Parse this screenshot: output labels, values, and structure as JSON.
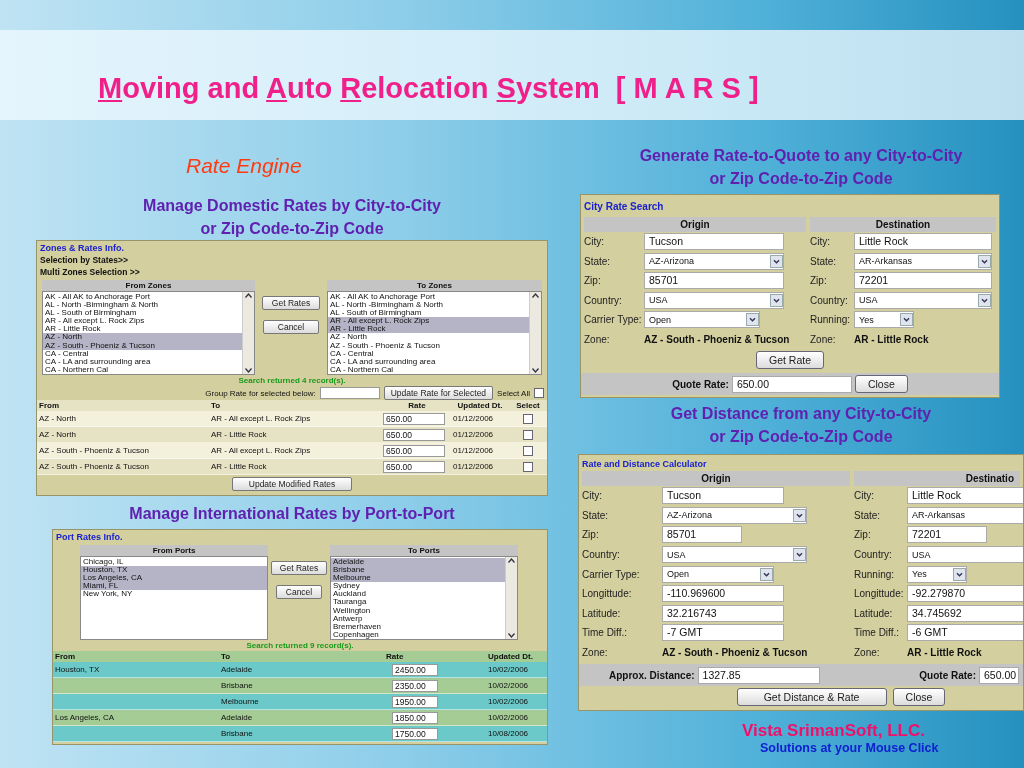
{
  "title": {
    "parts": [
      {
        "text": "M",
        "underlined": true
      },
      {
        "text": "oving and ",
        "underlined": false
      },
      {
        "text": "A",
        "underlined": true
      },
      {
        "text": "uto ",
        "underlined": false
      },
      {
        "text": "R",
        "underlined": true
      },
      {
        "text": "elocation ",
        "underlined": false
      },
      {
        "text": "S",
        "underlined": true
      },
      {
        "text": "ystem  [ M A R S ]",
        "underlined": false
      }
    ]
  },
  "left": {
    "subtitle": "Rate Engine",
    "domestic_heading": [
      "Manage Domestic Rates by City-to-City",
      "or Zip Code-to-Zip Code"
    ],
    "zones_panel": {
      "title": "Zones & Rates Info.",
      "links": [
        "Selection by States>>",
        "Multi Zones Selection >>"
      ],
      "from_list": {
        "header": "From Zones",
        "scrollbar": true,
        "items": [
          {
            "label": "AK - All AK to Anchorage Port",
            "selected": false
          },
          {
            "label": "AL - North -Birmingham & North",
            "selected": false
          },
          {
            "label": "AL - South of Birmingham",
            "selected": false
          },
          {
            "label": "AR - All except L. Rock Zips",
            "selected": false
          },
          {
            "label": "AR - Little Rock",
            "selected": false
          },
          {
            "label": "AZ - North",
            "selected": true
          },
          {
            "label": "AZ - South - Phoeniz & Tucson",
            "selected": true
          },
          {
            "label": "CA - Central",
            "selected": false
          },
          {
            "label": "CA - LA and surrounding area",
            "selected": false
          },
          {
            "label": "CA - Northern Cal",
            "selected": false
          }
        ]
      },
      "buttons": [
        "Get Rates",
        "Cancel"
      ],
      "to_list": {
        "header": "To Zones",
        "scrollbar": true,
        "items": [
          {
            "label": "AK - All AK to Anchorage Port",
            "selected": false
          },
          {
            "label": "AL - North -Birmingham & North",
            "selected": false
          },
          {
            "label": "AL - South of Birmingham",
            "selected": false
          },
          {
            "label": "AR - All except L. Rock Zips",
            "selected": true
          },
          {
            "label": "AR - Little Rock",
            "selected": true
          },
          {
            "label": "AZ - North",
            "selected": false
          },
          {
            "label": "AZ - South - Phoeniz & Tucson",
            "selected": false
          },
          {
            "label": "CA - Central",
            "selected": false
          },
          {
            "label": "CA - LA and surrounding area",
            "selected": false
          },
          {
            "label": "CA - Northern Cal",
            "selected": false
          }
        ]
      },
      "status": "Search returned 4 record(s).",
      "group_rate": {
        "label": "Group Rate for selected below:",
        "button": "Update Rate for Selected",
        "select_all": {
          "label": "Select All",
          "checked": false
        }
      },
      "table": {
        "columns": [
          "From",
          "To",
          "Rate",
          "Updated Dt.",
          "Select"
        ],
        "rows": [
          {
            "from": "AZ - North",
            "to": "AR - All except L. Rock Zips",
            "rate": "650.00",
            "updated": "01/12/2006",
            "checked": false
          },
          {
            "from": "AZ - North",
            "to": "AR - Little Rock",
            "rate": "650.00",
            "updated": "01/12/2006",
            "checked": false
          },
          {
            "from": "AZ - South - Phoeniz & Tucson",
            "to": "AR - All except L. Rock Zips",
            "rate": "650.00",
            "updated": "01/12/2006",
            "checked": false
          },
          {
            "from": "AZ - South - Phoeniz & Tucson",
            "to": "AR - Little Rock",
            "rate": "650.00",
            "updated": "01/12/2006",
            "checked": false
          }
        ]
      },
      "update_button": "Update Modified Rates"
    },
    "international_heading": "Manage International Rates by Port-to-Port",
    "ports_panel": {
      "title": "Port Rates Info.",
      "from_list": {
        "header": "From Ports",
        "scrollbar": false,
        "items": [
          {
            "label": "Chicago, IL",
            "selected": false
          },
          {
            "label": "Houston, TX",
            "selected": true
          },
          {
            "label": "Los Angeles, CA",
            "selected": true
          },
          {
            "label": "Miami, FL",
            "selected": true
          },
          {
            "label": "New York, NY",
            "selected": false
          }
        ]
      },
      "buttons": [
        "Get Rates",
        "Cancel"
      ],
      "to_list": {
        "header": "To Ports",
        "scrollbar": true,
        "items": [
          {
            "label": "Adelaide",
            "selected": true
          },
          {
            "label": "Brisbane",
            "selected": true
          },
          {
            "label": "Melbourne",
            "selected": true
          },
          {
            "label": "Sydney",
            "selected": false
          },
          {
            "label": "Auckland",
            "selected": false
          },
          {
            "label": "Tauranga",
            "selected": false
          },
          {
            "label": "Wellington",
            "selected": false
          },
          {
            "label": "Antwerp",
            "selected": false
          },
          {
            "label": "Bremerhaven",
            "selected": false
          },
          {
            "label": "Copenhagen",
            "selected": false
          }
        ]
      },
      "status": "Search returned 9 record(s).",
      "table": {
        "columns": [
          "From",
          "To",
          "Rate",
          "Updated Dt."
        ],
        "rows": [
          {
            "from": "Houston, TX",
            "to": "Adelaide",
            "rate": "2450.00",
            "updated": "10/02/2006"
          },
          {
            "to": "Brisbane",
            "rate": "2350.00",
            "updated": "10/02/2006"
          },
          {
            "to": "Melbourne",
            "rate": "1950.00",
            "updated": "10/02/2006"
          },
          {
            "from": "Los Angeles, CA",
            "to": "Adelaide",
            "rate": "1850.00",
            "updated": "10/02/2006"
          },
          {
            "to": "Brisbane",
            "rate": "1750.00",
            "updated": "10/08/2006"
          }
        ]
      }
    }
  },
  "right": {
    "quote_heading": [
      "Generate Rate-to-Quote to any City-to-City",
      "or Zip Code-to-Zip Code"
    ],
    "city_panel": {
      "title": "City Rate Search",
      "headers": [
        "Origin",
        "Destination"
      ],
      "origin": [
        {
          "label": "City:",
          "kind": "text",
          "value": "Tucson"
        },
        {
          "label": "State:",
          "kind": "select",
          "value": "AZ-Arizona"
        },
        {
          "label": "Zip:",
          "kind": "text",
          "value": "85701"
        },
        {
          "label": "Country:",
          "kind": "select",
          "value": "USA"
        },
        {
          "label": "Carrier Type:",
          "kind": "short-select",
          "value": "Open"
        },
        {
          "label": "Zone:",
          "kind": "zone",
          "value": "AZ - South - Phoeniz & Tucson"
        }
      ],
      "destination": [
        {
          "label": "City:",
          "kind": "text",
          "value": "Little Rock"
        },
        {
          "label": "State:",
          "kind": "select",
          "value": "AR-Arkansas"
        },
        {
          "label": "Zip:",
          "kind": "text",
          "value": "72201"
        },
        {
          "label": "Country:",
          "kind": "select",
          "value": "USA"
        },
        {
          "label": "Running:",
          "kind": "short-select",
          "value": "Yes"
        },
        {
          "label": "Zone:",
          "kind": "zone",
          "value": "AR - Little Rock"
        }
      ],
      "get_button": "Get Rate",
      "quote_label": "Quote Rate:",
      "quote_value": "650.00",
      "close_button": "Close"
    },
    "distance_heading": [
      "Get Distance from any City-to-City",
      "or Zip Code-to-Zip Code"
    ],
    "calc_panel": {
      "title": "Rate and Distance Calculator",
      "headers": [
        "Origin",
        "Destinatio"
      ],
      "origin": [
        {
          "label": "City:",
          "kind": "text",
          "value": "Tucson"
        },
        {
          "label": "State:",
          "kind": "select",
          "value": "AZ-Arizona"
        },
        {
          "label": "Zip:",
          "kind": "short-text",
          "value": "85701"
        },
        {
          "label": "Country:",
          "kind": "select",
          "value": "USA"
        },
        {
          "label": "Carrier Type:",
          "kind": "short-select",
          "value": "Open"
        },
        {
          "label": "Longittude:",
          "kind": "text",
          "value": "-110.969600"
        },
        {
          "label": "Latitude:",
          "kind": "text",
          "value": "32.216743"
        },
        {
          "label": "Time Diff.:",
          "kind": "text",
          "value": "-7 GMT"
        },
        {
          "label": "Zone:",
          "kind": "zone",
          "value": "AZ - South - Phoeniz & Tucson"
        }
      ],
      "destination": [
        {
          "label": "City:",
          "kind": "text",
          "value": "Little Rock"
        },
        {
          "label": "State:",
          "kind": "cut-select",
          "value": "AR-Arkansas"
        },
        {
          "label": "Zip:",
          "kind": "short-text",
          "value": "72201"
        },
        {
          "label": "Country:",
          "kind": "cut-select",
          "value": "USA"
        },
        {
          "label": "Running:",
          "kind": "short-select",
          "value": "Yes"
        },
        {
          "label": "Longittude:",
          "kind": "text",
          "value": "-92.279870"
        },
        {
          "label": "Latitude:",
          "kind": "text",
          "value": "34.745692"
        },
        {
          "label": "Time Diff.:",
          "kind": "text",
          "value": "-6 GMT"
        },
        {
          "label": "Zone:",
          "kind": "zone",
          "value": "AR - Little Rock"
        }
      ],
      "distance_label": "Approx. Distance:",
      "distance_value": "1327.85",
      "quote_label": "Quote Rate:",
      "quote_value": "650.00",
      "buttons": [
        "Get Distance & Rate",
        "Close"
      ]
    },
    "company": "Vista SrimanSoft, LLC.",
    "tagline": "Solutions at your Mouse Click"
  }
}
